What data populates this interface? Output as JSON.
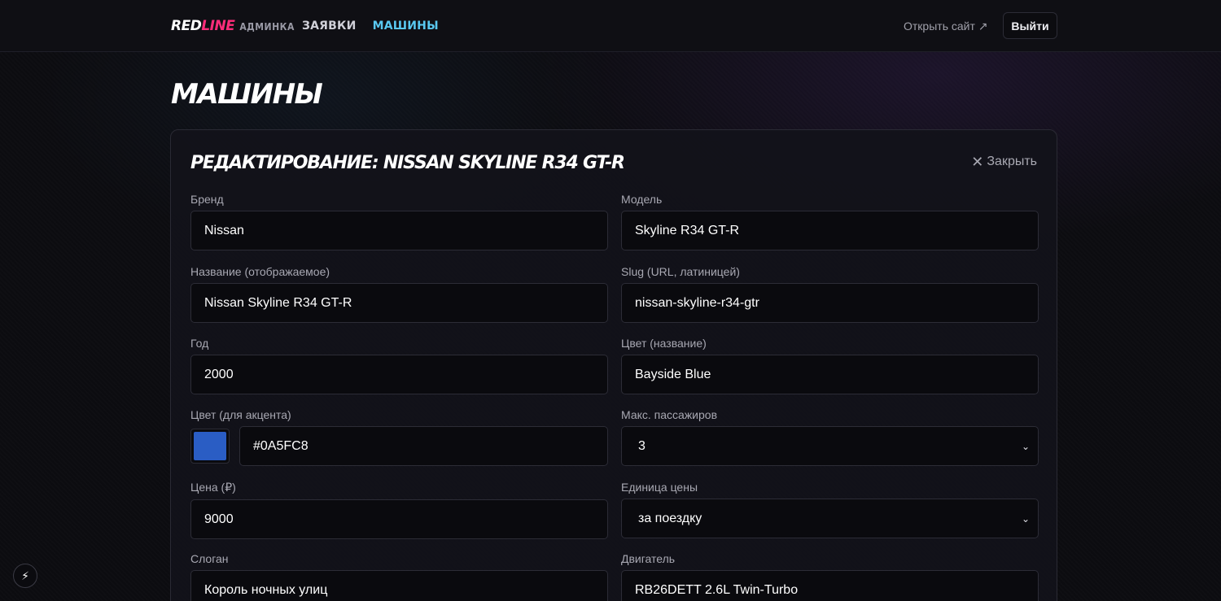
{
  "header": {
    "brand_red": "RED",
    "brand_line": "LINE",
    "brand_admin": "АДМИНКА",
    "nav_requests": "ЗАЯВКИ",
    "nav_cars": "МАШИНЫ",
    "open_site": "Открыть сайт ↗",
    "logout": "Выйти"
  },
  "page": {
    "title": "МАШИНЫ"
  },
  "editor": {
    "title": "РЕДАКТИРОВАНИЕ: NISSAN SKYLINE R34 GT-R",
    "close_label": "Закрыть",
    "fields": {
      "brand": {
        "label": "Бренд",
        "value": "Nissan"
      },
      "model": {
        "label": "Модель",
        "value": "Skyline R34 GT-R"
      },
      "name": {
        "label": "Название (отображаемое)",
        "value": "Nissan Skyline R34 GT-R"
      },
      "slug": {
        "label": "Slug (URL, латиницей)",
        "value": "nissan-skyline-r34-gtr"
      },
      "year": {
        "label": "Год",
        "value": "2000"
      },
      "color_name": {
        "label": "Цвет (название)",
        "value": "Bayside Blue"
      },
      "accent_color": {
        "label": "Цвет (для акцента)",
        "value": "#0A5FC8",
        "swatch": "#2a5dc4"
      },
      "max_passengers": {
        "label": "Макс. пассажиров",
        "value": "3"
      },
      "price": {
        "label": "Цена (₽)",
        "value": "9000"
      },
      "price_unit": {
        "label": "Единица цены",
        "value": "за поездку"
      },
      "slogan": {
        "label": "Слоган",
        "value": "Король ночных улиц"
      },
      "engine": {
        "label": "Двигатель",
        "value": "RB26DETT 2.6L Twin-Turbo"
      }
    }
  },
  "colors": {
    "accent_pink": "#ff2d7a",
    "accent_cyan": "#59c8f0",
    "background": "#0c0c10"
  }
}
